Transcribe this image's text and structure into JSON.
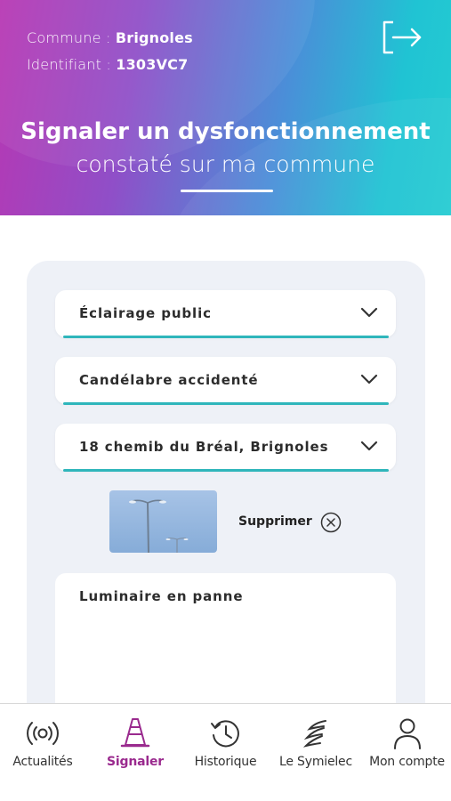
{
  "header": {
    "commune_label": "Commune : ",
    "commune_value": "Brignoles",
    "identifiant_label": "Identifiant : ",
    "identifiant_value": "1303VC7",
    "title_line1": "Signaler un dysfonctionnement",
    "title_line2": "constaté sur ma commune",
    "logout_icon": "logout-icon"
  },
  "form": {
    "category_value": "Éclairage public",
    "problem_value": "Candélabre accidenté",
    "address_value": "18 chemib du Bréal, Brignoles",
    "photo_icon": "street-lamp-photo",
    "delete_label": "Supprimer",
    "description_value": "Luminaire en panne"
  },
  "nav": {
    "items": [
      {
        "label": "Actualités",
        "icon": "broadcast-icon"
      },
      {
        "label": "Signaler",
        "icon": "traffic-cone-icon",
        "active": true
      },
      {
        "label": "Historique",
        "icon": "history-clock-icon"
      },
      {
        "label": "Le Symielec",
        "icon": "symielec-logo-icon"
      },
      {
        "label": "Mon compte",
        "icon": "user-account-icon"
      }
    ]
  },
  "colors": {
    "accent_teal": "#2fb6bb",
    "active_purple": "#9a2a8e",
    "header_gradient_start": "#b737b3",
    "header_gradient_end": "#25ccd2"
  }
}
